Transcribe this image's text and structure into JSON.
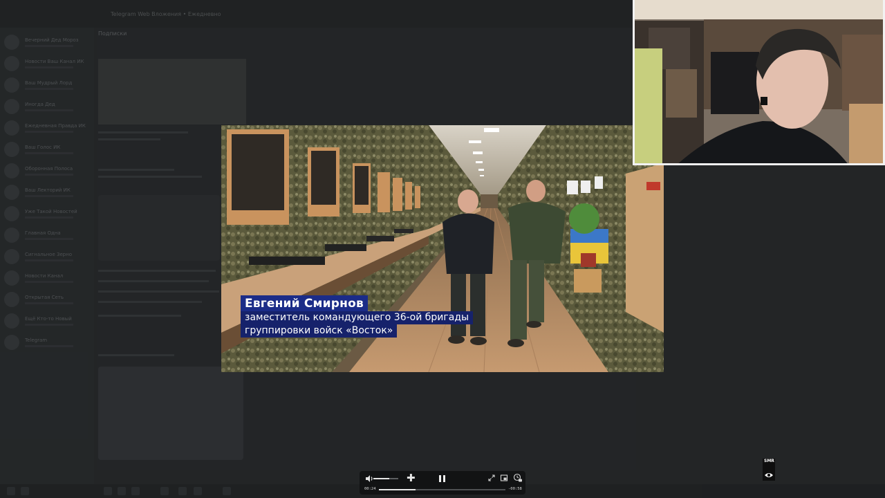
{
  "background_app": {
    "window_title": "Telegram Web Вложения • Ежедневно",
    "feed_header": "Подписки",
    "chats": [
      "Вечерний Дед Мороз",
      "Новости Ваш Канал ИК",
      "Ваш Мудрый Лорд",
      "Иногда Дед",
      "Ежедневная Правда ИК",
      "Ваш Голос ИК",
      "Оборонная Полоса",
      "Ваш Лекторий ИК",
      "Уже Такой Новостей",
      "Главная Одна",
      "Сигнальное Зерно",
      "Новости Канал",
      "Открытая Сеть",
      "Ещё Кто-то Новый",
      "Telegram"
    ]
  },
  "video": {
    "lower_third": {
      "name": "Евгений Смирнов",
      "line1": "заместитель командующего 36-ой бригады",
      "line2": "группировки войск «Восток»"
    }
  },
  "player": {
    "time_elapsed": "00:24",
    "time_remaining": "-00:58",
    "progress": 0.29,
    "volume": 0.65
  },
  "badge": {
    "text": "SMR"
  },
  "colors": {
    "lower_third_name_bg": "#1b2c88",
    "lower_third_line_bg": "#16226b",
    "controls_bg": "#121314"
  },
  "icons": [
    "volume-icon",
    "plus-icon",
    "pause-icon",
    "fullscreen-icon",
    "pip-icon",
    "playback-speed-icon",
    "eye-icon"
  ]
}
